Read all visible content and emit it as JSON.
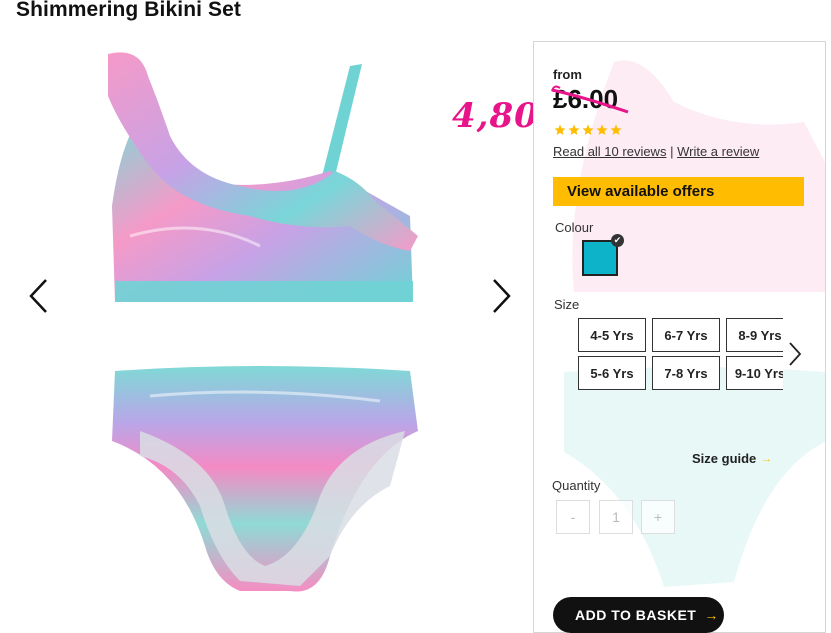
{
  "product": {
    "title": "Shimmering Bikini Set"
  },
  "annotation": {
    "handwritten_price": "4,80"
  },
  "gallery": {
    "image_alt": "Shimmering bikini set image",
    "prev_label": "previous",
    "next_label": "next"
  },
  "pricing": {
    "from_label": "from",
    "price": "£6.00",
    "rating_stars": 5,
    "read_reviews": "Read all 10 reviews",
    "separator": "|",
    "write_review": "Write a review"
  },
  "offers_button": "View available offers",
  "colour": {
    "label": "Colour",
    "selected_hex": "#0db3c9"
  },
  "size": {
    "label": "Size",
    "options": [
      "4-5 Yrs",
      "6-7 Yrs",
      "8-9 Yrs",
      "5-6 Yrs",
      "7-8 Yrs",
      "9-10 Yrs"
    ],
    "guide": "Size guide"
  },
  "quantity": {
    "label": "Quantity",
    "minus": "-",
    "value": "1",
    "plus": "+"
  },
  "basket_button": "ADD TO BASKET",
  "colors": {
    "accent_yellow": "#ffbc00",
    "annotation_pink": "#e8158a",
    "swatch_teal": "#0db3c9"
  }
}
